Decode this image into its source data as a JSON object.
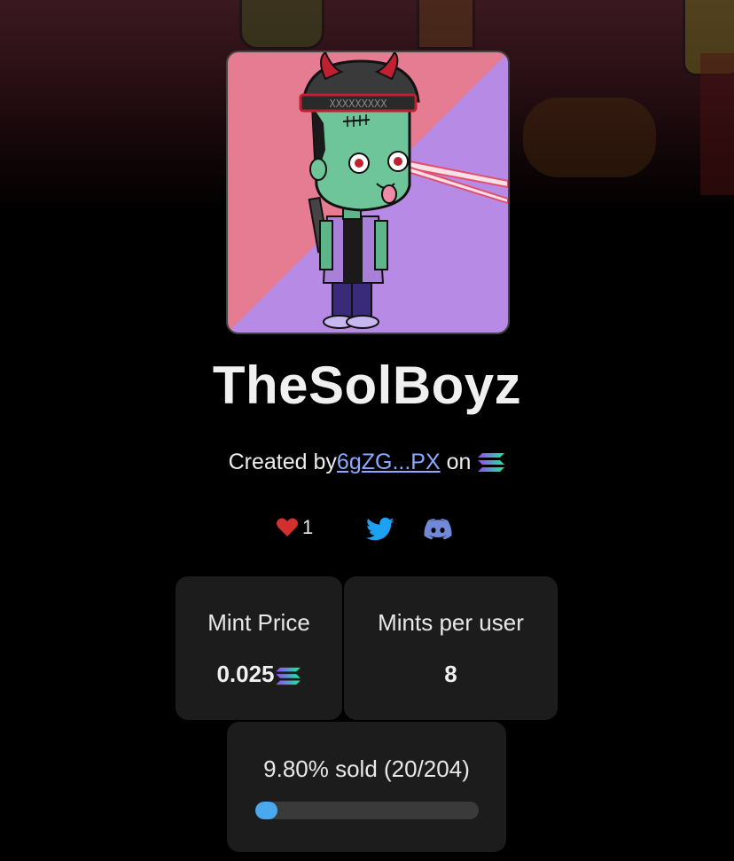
{
  "collection": {
    "name": "TheSolBoyz",
    "created_by_prefix": "Created by",
    "creator_address": "6gZG...PX",
    "on_text": "on",
    "chain_icon": "solana-icon"
  },
  "social": {
    "likes": "1",
    "like_icon": "heart-icon",
    "twitter_icon": "twitter-icon",
    "discord_icon": "discord-icon"
  },
  "stats": {
    "mint_price_label": "Mint Price",
    "mint_price_value": "0.025",
    "mints_per_user_label": "Mints per user",
    "mints_per_user_value": "8"
  },
  "progress": {
    "label": "9.80% sold (20/204)",
    "fraction": 0.098
  },
  "colors": {
    "background": "#000000",
    "card": "#1c1c1c",
    "accent": "#4aa8ec",
    "link": "#8ea8ff",
    "heart": "#d32f2f",
    "twitter": "#1da1f2",
    "discord": "#7289da"
  }
}
